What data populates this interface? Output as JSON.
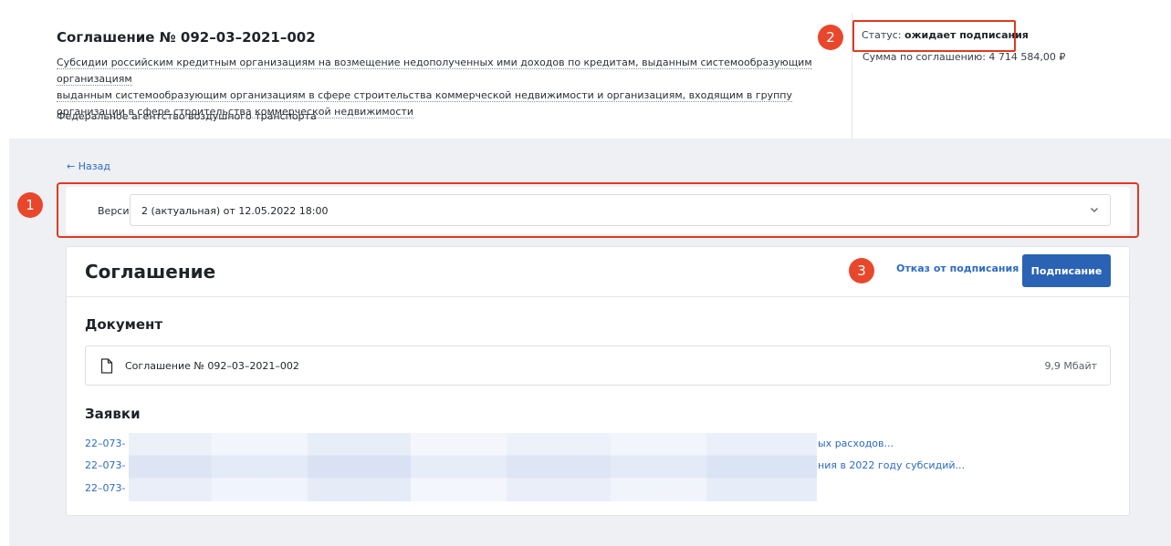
{
  "agreement": {
    "title": "Соглашение № 092–03–2021–002",
    "description_lines": [
      "Субсидии российским кредитным организациям на возмещение недополученных ими доходов по кредитам, выданным системообразующим организациям",
      "выданным системообразующим организациям в сфере строительства коммерческой недвижимости и организациям, входящим в группу",
      "организации в сфере строительства коммерческой недвижимости"
    ],
    "agency": "Федеральное агентство воздушного транспорта",
    "status_label": "Статус:",
    "status_value": "ожидает подписания",
    "sum_label": "Сумма по соглашению:",
    "sum_value": "4 714 584,00 ₽"
  },
  "markers": [
    "1",
    "2",
    "3"
  ],
  "nav": {
    "back": "← Назад"
  },
  "version": {
    "label": "Версия:",
    "selected": "2 (актуальная) от 12.05.2022 18:00"
  },
  "card": {
    "title": "Соглашение",
    "refuse_label": "Отказ от подписания",
    "sign_label": "Подписание",
    "document_section": "Документ",
    "document_name": "Соглашение № 092–03–2021–002",
    "document_size": "9,9 Мбайт",
    "applications_section": "Заявки",
    "applications": [
      {
        "prefix": "22–073-",
        "tail": "ых расходов..."
      },
      {
        "prefix": "22–073-",
        "tail": "ния в 2022 году субсидий..."
      },
      {
        "prefix": "22–073-",
        "tail": ""
      }
    ]
  },
  "icons": [
    "arrow-left-icon",
    "chevron-down-icon",
    "file-icon"
  ],
  "colors": {
    "accent": "#2a62b4",
    "link": "#2d6bc4",
    "highlight": "#e0391f",
    "marker": "#e8472c",
    "page_bg": "#eef0f3"
  }
}
